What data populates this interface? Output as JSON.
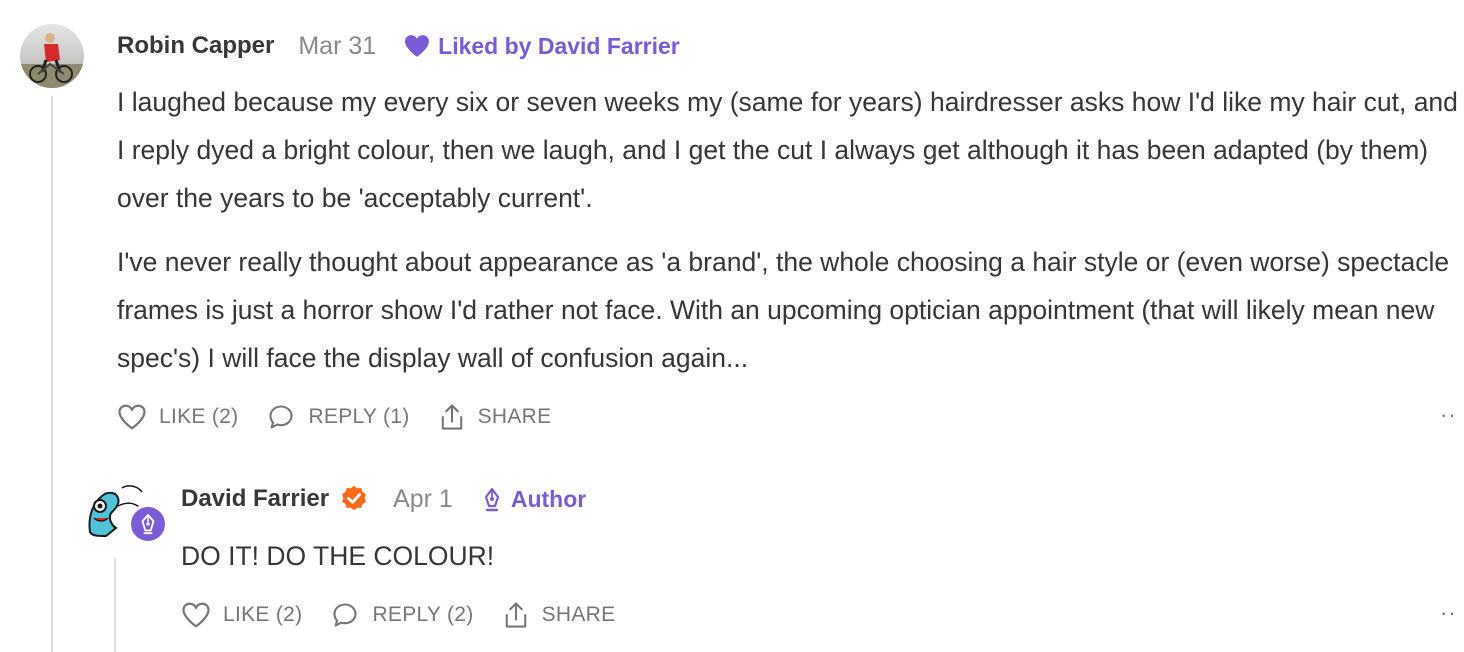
{
  "comments": [
    {
      "author": "Robin Capper",
      "date": "Mar 31",
      "liked_by": "Liked by David Farrier",
      "paragraphs": [
        "I laughed because my every six or seven weeks my (same for years) hairdresser asks how I'd like my hair cut, and I reply dyed a bright colour, then we laugh, and I get the cut I always get although it has been adapted (by them) over the years to be 'acceptably current'.",
        "I've never really thought about appearance as 'a brand', the whole choosing a hair style or (even worse) spectacle frames is just a horror show I'd rather not face. With an upcoming optician appointment (that will likely mean new spec's) I will face the display wall of confusion again..."
      ],
      "like_label": "LIKE (2)",
      "reply_label": "REPLY (1)",
      "share_label": "SHARE",
      "more_label": "··"
    },
    {
      "author": "David Farrier",
      "date": "Apr 1",
      "author_tag": "Author",
      "paragraphs": [
        "DO IT! DO THE COLOUR!"
      ],
      "like_label": "LIKE (2)",
      "reply_label": "REPLY (2)",
      "share_label": "SHARE",
      "more_label": "··"
    }
  ],
  "colors": {
    "accent": "#7b5cd6",
    "verified": "#ff6719",
    "text": "#363737",
    "muted": "#777777"
  },
  "icons": [
    "heart-icon",
    "comment-bubble-icon",
    "share-icon",
    "verified-check-icon",
    "pen-nib-icon",
    "more-icon"
  ]
}
